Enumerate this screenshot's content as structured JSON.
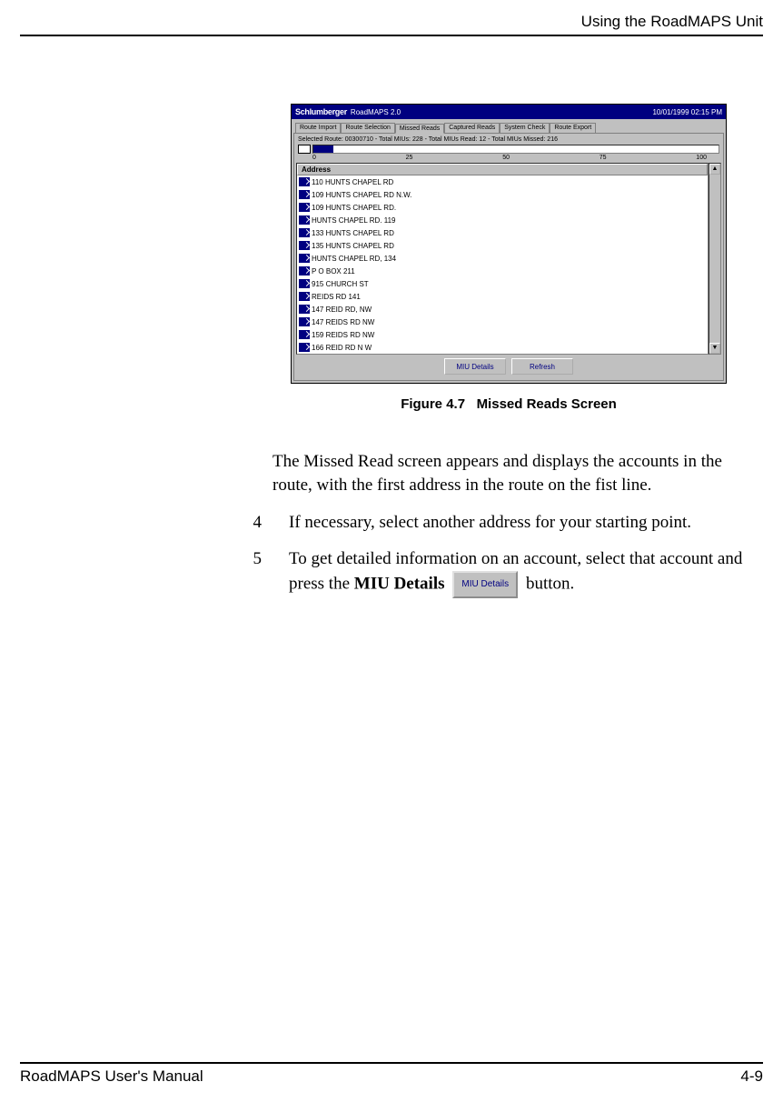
{
  "header": {
    "section_title": "Using the RoadMAPS Unit"
  },
  "screenshot": {
    "brand": "Schlumberger",
    "app_title": "RoadMAPS 2.0",
    "datetime": "10/01/1999 02:15 PM",
    "tabs": [
      "Route Import",
      "Route Selection",
      "Missed Reads",
      "Captured Reads",
      "System Check",
      "Route Export"
    ],
    "active_tab_index": 2,
    "status_line": "Selected Route: 00300710 - Total MIUs: 228 - Total MIUs Read: 12 - Total MIUs Missed: 216",
    "scale": {
      "t0": "0",
      "t1": "25",
      "t2": "50",
      "t3": "75",
      "t4": "100"
    },
    "address_header": "Address",
    "addresses": [
      "110 HUNTS CHAPEL RD",
      "109 HUNTS CHAPEL RD N.W.",
      "109 HUNTS CHAPEL RD.",
      "HUNTS CHAPEL RD. 119",
      "133 HUNTS CHAPEL RD",
      "135 HUNTS CHAPEL RD",
      "HUNTS CHAPEL RD, 134",
      "P O BOX 211",
      "915 CHURCH ST",
      "REIDS RD 141",
      "147 REID RD, NW",
      "147 REIDS RD NW",
      "159 REIDS RD NW",
      "166 REID RD N W"
    ],
    "buttons": {
      "miu_details": "MIU Details",
      "refresh": "Refresh"
    }
  },
  "figure_caption": {
    "label": "Figure 4.7",
    "title": "Missed Reads Screen"
  },
  "body": {
    "para1": "The Missed Read screen appears and displays the accounts in the route, with the first address in the route on the fist line.",
    "step4_num": "4",
    "step4_text": "If necessary, select another address for your starting point.",
    "step5_num": "5",
    "step5_text_a": "To get detailed information on an account, select that account and press the ",
    "step5_bold": "MIU Details",
    "step5_btn": "MIU Details",
    "step5_text_b": " button."
  },
  "footer": {
    "manual": "RoadMAPS User's Manual",
    "page": "4-9"
  }
}
